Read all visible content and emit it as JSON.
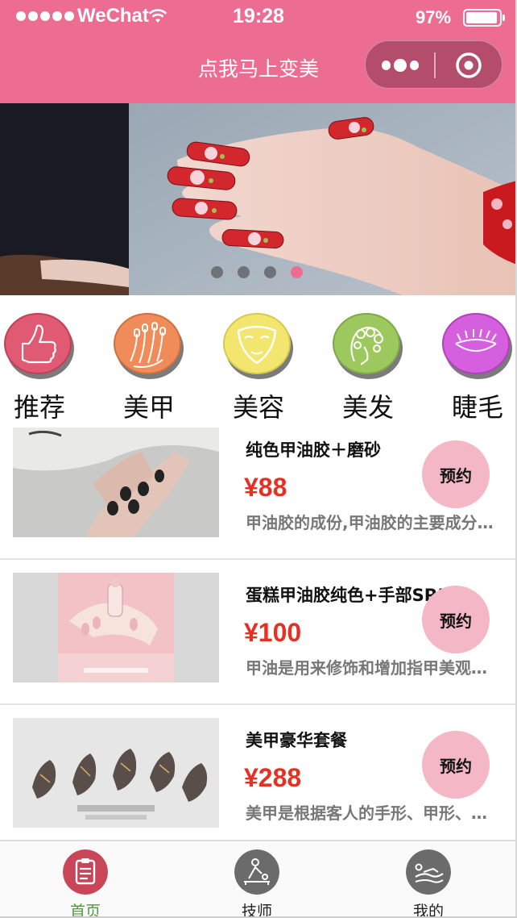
{
  "status_bar": {
    "carrier": "WeChat",
    "time": "19:28",
    "battery": "97%"
  },
  "navbar": {
    "title": "点我马上变美",
    "menu_icon": "more-dots-icon",
    "close_icon": "target-close-icon"
  },
  "banner": {
    "slide_count": 4,
    "active_index": 3
  },
  "categories": [
    {
      "label": "推荐",
      "icon": "thumbs-up-icon",
      "color": "#e05a73"
    },
    {
      "label": "美甲",
      "icon": "nail-hand-icon",
      "color": "#ef8c5a"
    },
    {
      "label": "美容",
      "icon": "face-mask-icon",
      "color": "#f3e66e"
    },
    {
      "label": "美发",
      "icon": "curly-hair-icon",
      "color": "#9cc85e"
    },
    {
      "label": "睫毛",
      "icon": "eyelash-icon",
      "color": "#d65fe0"
    }
  ],
  "products": [
    {
      "name": "纯色甲油胶＋磨砂",
      "price": "¥88",
      "desc": "甲油胶的成份,甲油胶的主要成分是…",
      "button": "预约"
    },
    {
      "name": "蛋糕甲油胶纯色+手部SPA",
      "price": "¥100",
      "desc": "甲油是用来修饰和增加指甲美观的…",
      "button": "预约"
    },
    {
      "name": "美甲豪华套餐",
      "price": "¥288",
      "desc": "美甲是根据客人的手形、甲形、肤…",
      "button": "预约"
    }
  ],
  "tabbar": [
    {
      "label": "首页",
      "icon": "clipboard-icon",
      "active": true
    },
    {
      "label": "技师",
      "icon": "massage-icon",
      "active": false
    },
    {
      "label": "我的",
      "icon": "lounge-icon",
      "active": false
    }
  ],
  "colors": {
    "brand": "#ec6d91",
    "price": "#e33124",
    "book_button": "#f4b7c6",
    "active_tab_text": "#4e9a3a"
  }
}
